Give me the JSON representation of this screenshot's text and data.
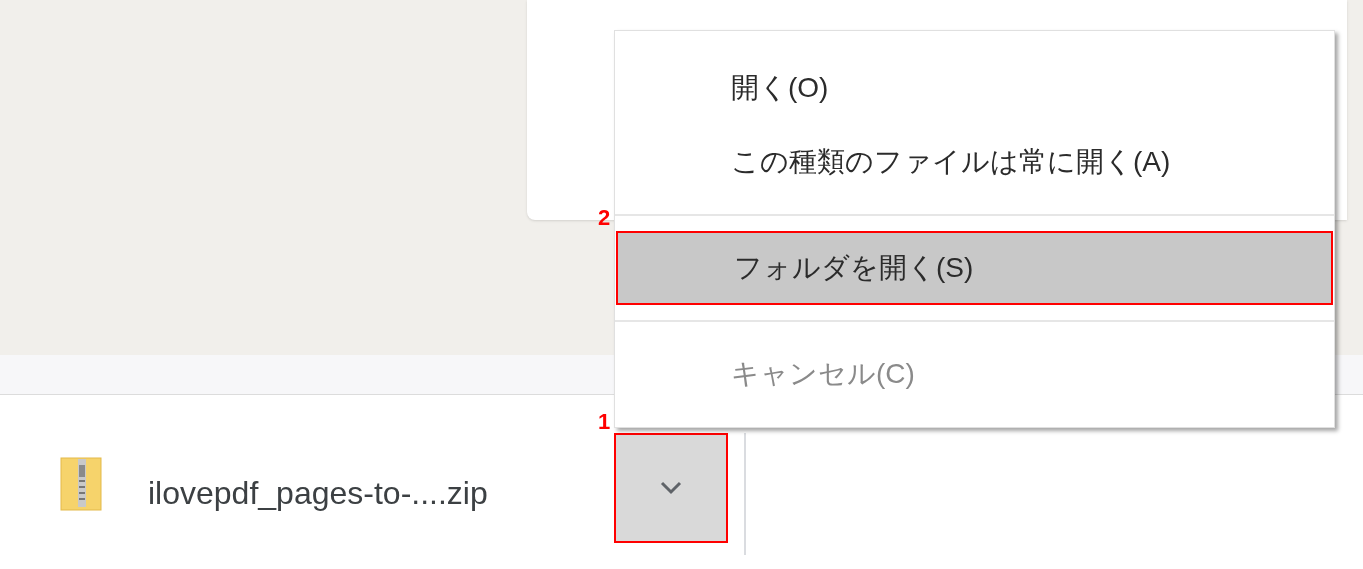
{
  "download_bar": {
    "filename": "ilovepdf_pages-to-....zip",
    "menu_button": {
      "expanded": true,
      "annotation": "1"
    }
  },
  "context_menu": {
    "items": [
      {
        "kind": "item",
        "label": "開く(O)",
        "selected": false,
        "disabled": false
      },
      {
        "kind": "item",
        "label": "この種類のファイルは常に開く(A)",
        "selected": false,
        "disabled": false
      },
      {
        "kind": "separator"
      },
      {
        "kind": "item",
        "label": "フォルダを開く(S)",
        "selected": true,
        "disabled": false,
        "annotation": "2"
      },
      {
        "kind": "separator"
      },
      {
        "kind": "item",
        "label": "キャンセル(C)",
        "selected": false,
        "disabled": true
      }
    ]
  }
}
